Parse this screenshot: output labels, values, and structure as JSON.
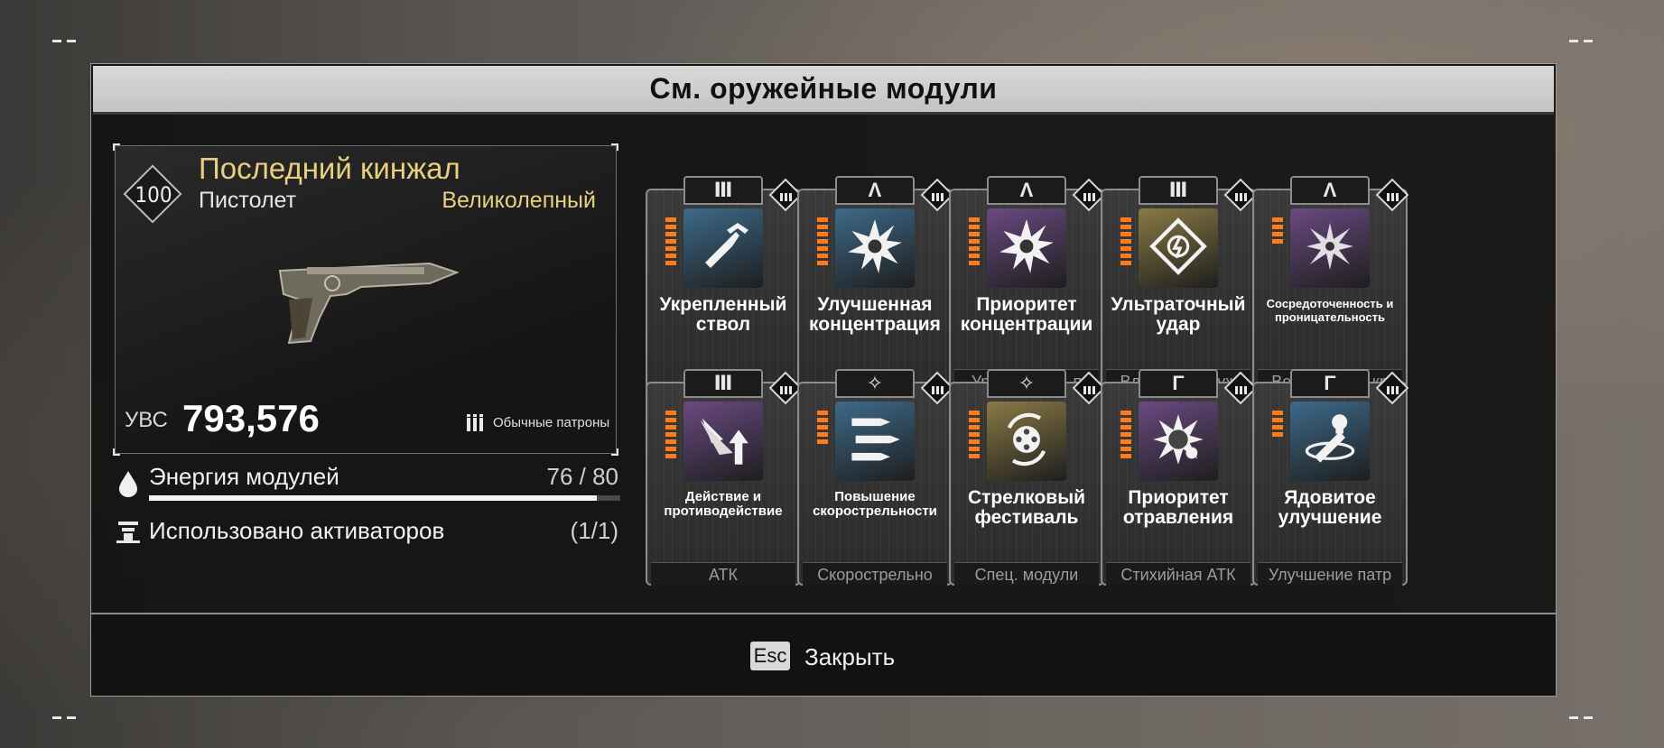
{
  "title": "См. оружейные модули",
  "weapon": {
    "level": "100",
    "name": "Последний кинжал",
    "type": "Пистолет",
    "rarity": "Великолепный",
    "uvs_label": "УВС",
    "uvs_value": "793,576",
    "ammo_label": "Обычные патроны",
    "ammo_icon": "ammo-icon"
  },
  "energy": {
    "label": "Энергия модулей",
    "value": "76 / 80",
    "current": 76,
    "max": 80
  },
  "activators": {
    "label": "Использовано активаторов",
    "value": "(1/1)"
  },
  "modules": [
    {
      "name": "Укрепленный ствол",
      "footer": "",
      "tab": "Ⅲ",
      "color": "#3d6a8a",
      "pips": 7,
      "icon": "bullet-icon"
    },
    {
      "name": "Улучшенная концентрация",
      "footer": "",
      "tab": "Λ",
      "color": "#3d6a8a",
      "pips": 7,
      "icon": "star-burst-icon"
    },
    {
      "name": "Приоритет концентрации",
      "footer": "Урон от крит. п",
      "tab": "Λ",
      "color": "#6a4a82",
      "pips": 7,
      "icon": "star-burst-icon"
    },
    {
      "name": "Ультраточный удар",
      "footer": "Владение оруж",
      "tab": "Ⅲ",
      "color": "#8a7a45",
      "pips": 7,
      "icon": "diamond-target-icon"
    },
    {
      "name": "Сосредоточенность и проницательность",
      "footer": "Вероятность кр",
      "tab": "Λ",
      "color": "#6a4a82",
      "pips": 4,
      "icon": "shatter-star-icon"
    },
    {
      "name": "Действие и противодействие",
      "footer": "АТК",
      "tab": "Ⅲ",
      "color": "#6a4a82",
      "pips": 7,
      "icon": "arrow-impact-icon"
    },
    {
      "name": "Повышение скорострельности",
      "footer": "Скорострельно",
      "tab": "✧",
      "color": "#3d6a8a",
      "pips": 5,
      "icon": "bullets-icon"
    },
    {
      "name": "Стрелковый фестиваль",
      "footer": "Спец. модули",
      "tab": "✧",
      "color": "#8a7a45",
      "pips": 7,
      "icon": "cylinder-icon"
    },
    {
      "name": "Приоритет отравления",
      "footer": "Стихийная АТК",
      "tab": "Γ",
      "color": "#6a4a82",
      "pips": 7,
      "icon": "poison-burst-icon"
    },
    {
      "name": "Ядовитое улучшение",
      "footer": "Улучшение патр",
      "tab": "Γ",
      "color": "#3d6a8a",
      "pips": 4,
      "icon": "poison-bullet-icon"
    }
  ],
  "footer": {
    "key": "Esc",
    "label": "Закрыть"
  }
}
